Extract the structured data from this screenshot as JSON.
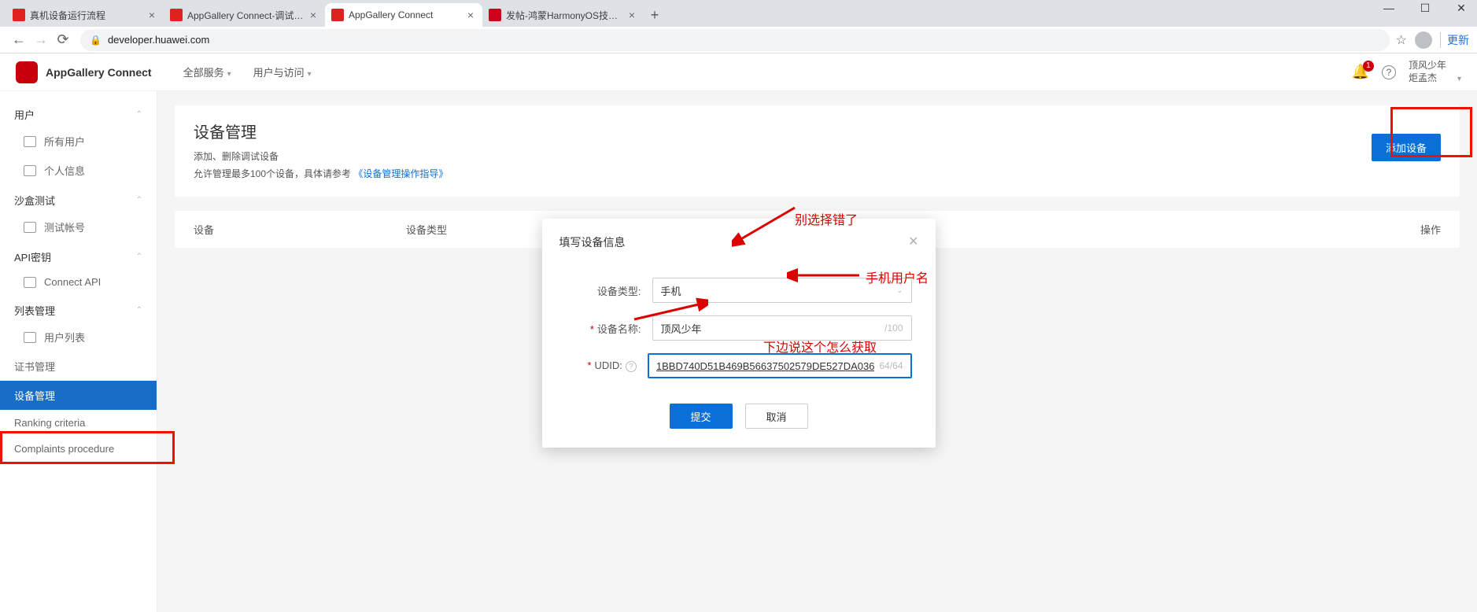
{
  "browser": {
    "tabs": [
      {
        "title": "真机设备运行流程"
      },
      {
        "title": "AppGallery Connect-调试Harm"
      },
      {
        "title": "AppGallery Connect"
      },
      {
        "title": "发帖-鸿蒙HarmonyOS技术社区"
      }
    ],
    "newtab": "+",
    "win": {
      "min": "—",
      "max": "☐",
      "close": "✕"
    },
    "nav": {
      "back": "←",
      "fwd": "→",
      "reload": "⟳"
    },
    "url_lock": "🔒",
    "url": "developer.huawei.com",
    "star": "☆",
    "more": "更新"
  },
  "header": {
    "app_title": "AppGallery Connect",
    "menu1": "全部服务",
    "menu2": "用户与访问",
    "bell_badge": "1",
    "help": "?",
    "user_name": "顶风少年",
    "user_sub": "炬孟杰"
  },
  "sidebar": {
    "g_user": "用户",
    "i_all_users": "所有用户",
    "i_profile": "个人信息",
    "g_sandbox": "沙盒测试",
    "i_test_acct": "测试帐号",
    "g_api": "API密钥",
    "i_connect_api": "Connect API",
    "g_list": "列表管理",
    "i_user_list": "用户列表",
    "i_cert": "证书管理",
    "i_device": "设备管理",
    "i_ranking": "Ranking criteria",
    "i_complaints": "Complaints procedure"
  },
  "page": {
    "title": "设备管理",
    "desc1": "添加、删除调试设备",
    "desc2": "允许管理最多100个设备，具体请参考",
    "desc_link": "《设备管理操作指导》",
    "add_btn": "添加设备",
    "col_device": "设备",
    "col_type": "设备类型",
    "col_op": "操作"
  },
  "modal": {
    "title": "填写设备信息",
    "label_type": "设备类型:",
    "value_type": "手机",
    "label_name": "设备名称:",
    "value_name": "顶风少年",
    "counter_name": "/100",
    "label_udid": "UDID:",
    "value_udid": "1BBD740D51B469B56637502579DE527DA036",
    "counter_udid": "64/64",
    "submit": "提交",
    "cancel": "取消"
  },
  "annotations": {
    "a1": "别选择错了",
    "a2": "手机用户名",
    "a3": "下边说这个怎么获取"
  }
}
